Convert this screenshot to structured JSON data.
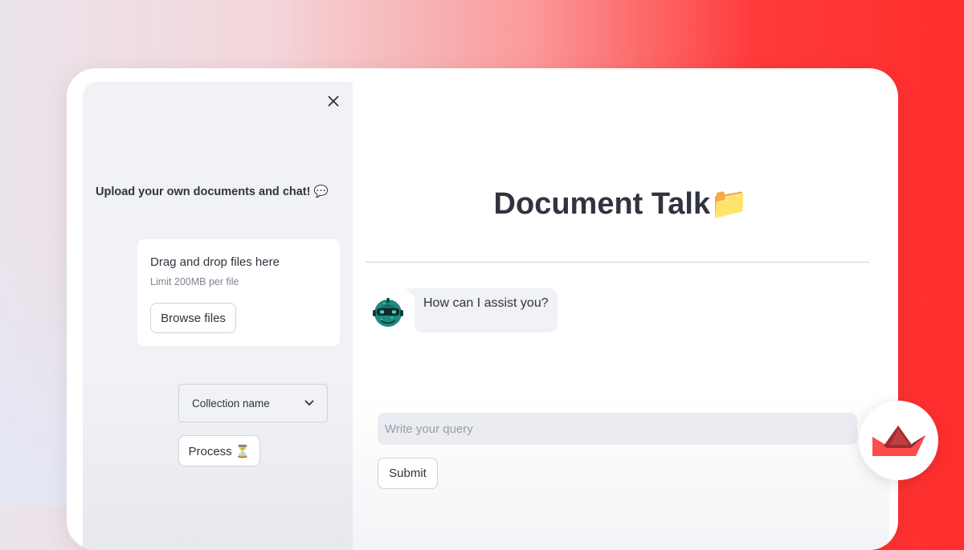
{
  "sidebar": {
    "close_glyph": "✕",
    "title": "Upload your own documents and chat! 💬",
    "uploader": {
      "drag_text": "Drag and drop files here",
      "limit_text": "Limit 200MB per file",
      "browse_label": "Browse files"
    },
    "collection_select": {
      "selected": "Collection name",
      "icon": "chevron-down-icon"
    },
    "process_label": "Process ⏳"
  },
  "main": {
    "title": "Document Talk📁",
    "chat": [
      {
        "role": "assistant",
        "text": "How can I assist you?",
        "avatar_icon": "robot-avatar-icon"
      }
    ],
    "query_input": {
      "value": "",
      "placeholder": "Write your query"
    },
    "submit_label": "Submit"
  },
  "brand": {
    "logo_icon": "streamlit-crown-logo",
    "accent": "#ff4b4b"
  },
  "colors": {
    "sidebar_bg": "#f0f2f6",
    "text": "#31333f",
    "muted": "#808495",
    "border": "#cfd2d9"
  }
}
